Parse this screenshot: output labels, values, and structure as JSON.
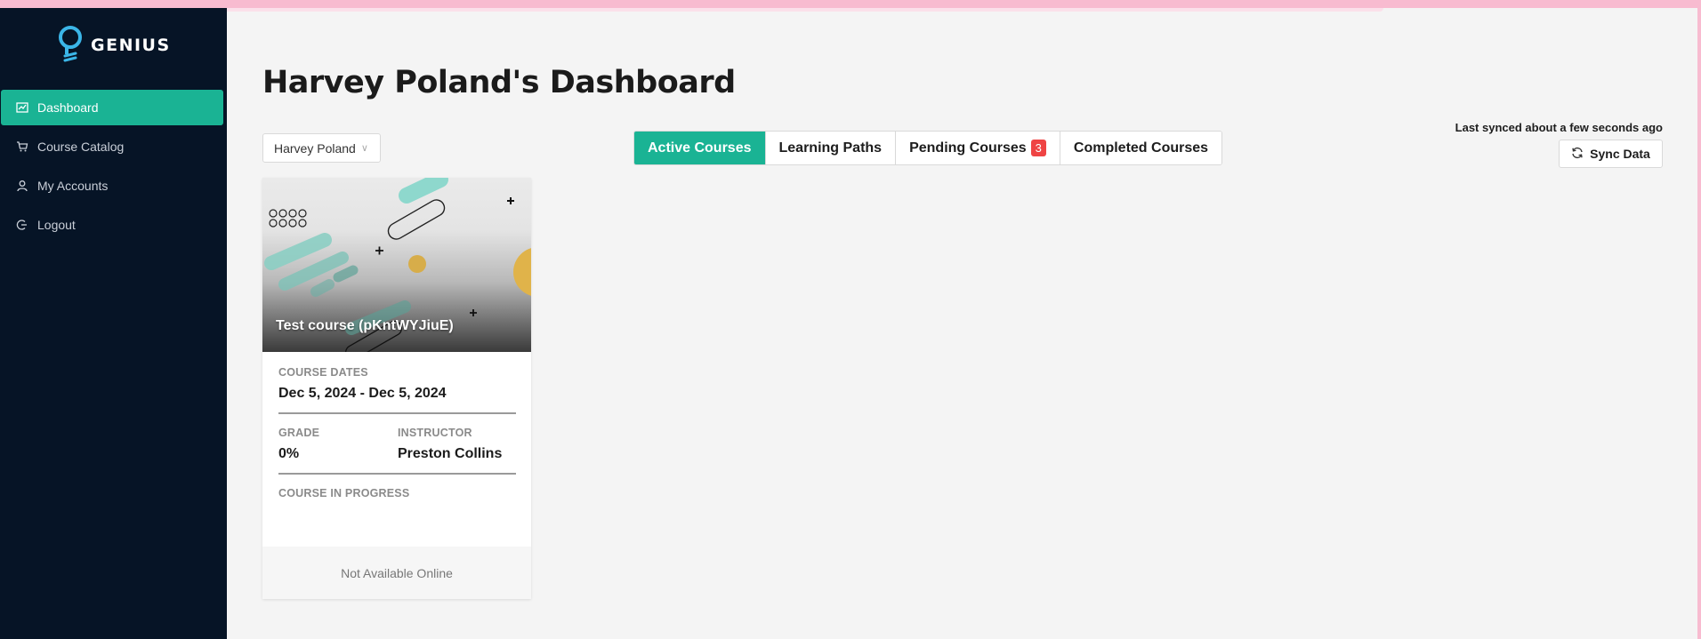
{
  "app": {
    "brand": "GENIUS",
    "accent_color": "#1ab394"
  },
  "sidebar": {
    "items": [
      {
        "label": "Dashboard",
        "icon": "chart-icon",
        "active": true
      },
      {
        "label": "Course Catalog",
        "icon": "cart-icon",
        "active": false
      },
      {
        "label": "My Accounts",
        "icon": "user-icon",
        "active": false
      },
      {
        "label": "Logout",
        "icon": "logout-icon",
        "active": false
      }
    ]
  },
  "main": {
    "title": "Harvey Poland's Dashboard",
    "user_select": {
      "value": "Harvey Poland"
    },
    "tabs": [
      {
        "label": "Active Courses",
        "active": true
      },
      {
        "label": "Learning Paths",
        "active": false
      },
      {
        "label": "Pending Courses",
        "badge": "3",
        "active": false
      },
      {
        "label": "Completed Courses",
        "active": false
      }
    ],
    "sync": {
      "status": "Last synced about a few seconds ago",
      "button_label": "Sync Data"
    },
    "courses": [
      {
        "title": "Test course (pKntWYJiuE)",
        "dates_label": "COURSE DATES",
        "dates": "Dec 5, 2024 - Dec 5, 2024",
        "grade_label": "GRADE",
        "grade": "0%",
        "instructor_label": "INSTRUCTOR",
        "instructor": "Preston Collins",
        "status_label": "COURSE IN PROGRESS",
        "footer": "Not Available Online"
      }
    ]
  }
}
